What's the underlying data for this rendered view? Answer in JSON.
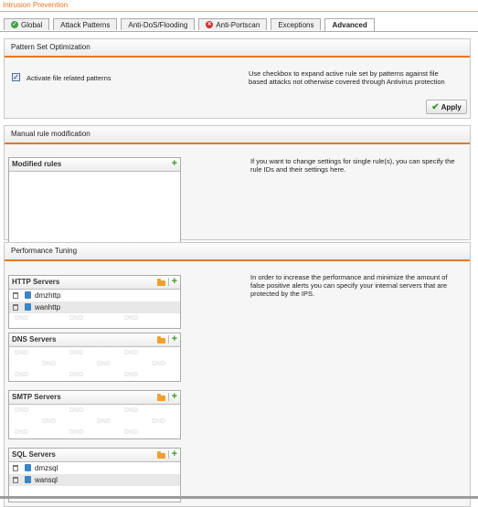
{
  "page": {
    "title": "Intrusion Prevention"
  },
  "tabs": [
    {
      "label": "Global",
      "icon": "green-check-icon"
    },
    {
      "label": "Attack Patterns"
    },
    {
      "label": "Anti-DoS/Flooding"
    },
    {
      "label": "Anti-Portscan",
      "icon": "red-x-icon"
    },
    {
      "label": "Exceptions"
    },
    {
      "label": "Advanced"
    }
  ],
  "pattern_set": {
    "header": "Pattern Set Optimization",
    "checkbox_label": "Activate file related patterns",
    "checkbox_checked": true,
    "description": "Use checkbox to expand active rule set by patterns against file based attacks not otherwise covered through Antivirus protection",
    "apply_label": "Apply"
  },
  "manual": {
    "header": "Manual rule modification",
    "box_title": "Modified rules",
    "description": "If you want to change settings for single rule(s), you can specify the rule IDs and their settings here."
  },
  "performance": {
    "header": "Performance Tuning",
    "description": "In order to increase the performance and minimize the amount of false positive alerts you can specify your internal servers that are protected by the IPS.",
    "dnd_text": "DND",
    "http": {
      "title": "HTTP Servers",
      "items": [
        "dmzhttp",
        "wanhttp"
      ]
    },
    "dns": {
      "title": "DNS Servers"
    },
    "smtp": {
      "title": "SMTP Servers"
    },
    "sql": {
      "title": "SQL Servers",
      "items": [
        "dmzsql",
        "wansql"
      ]
    }
  },
  "colors": {
    "accent": "#e87722",
    "add": "#3c9a2e",
    "host_icon": "#3a84c8"
  }
}
